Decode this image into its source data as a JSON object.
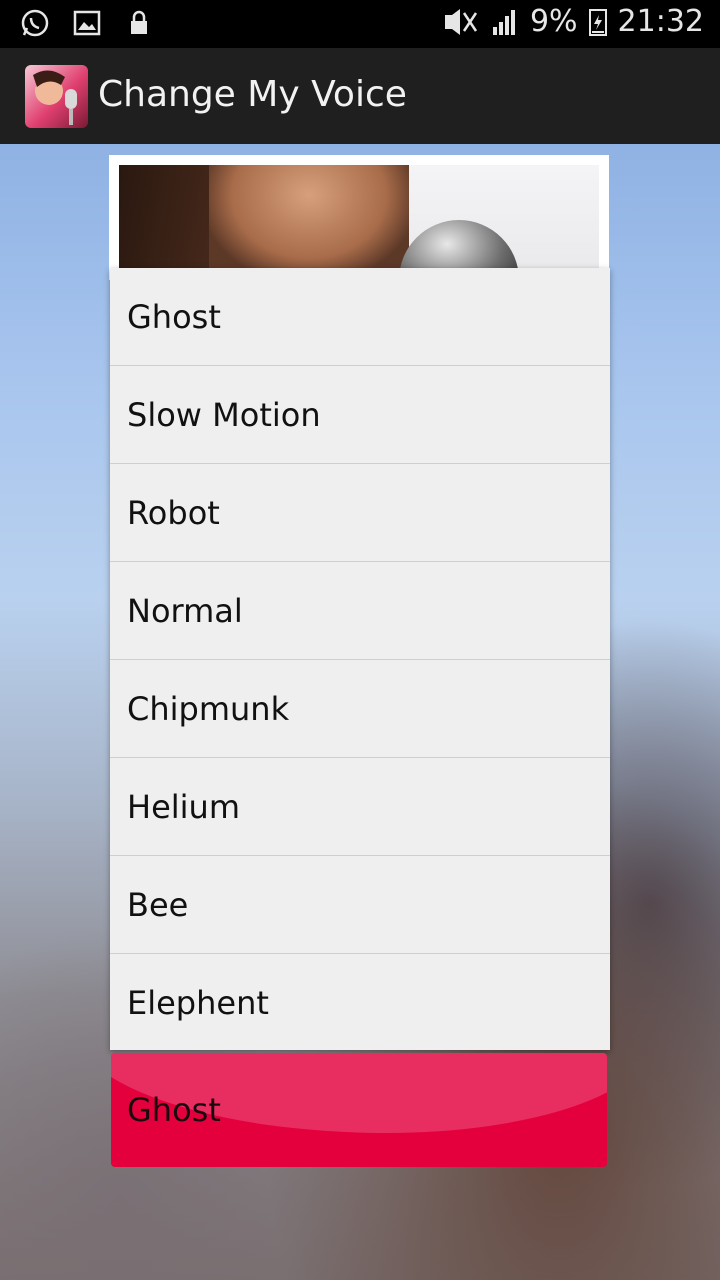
{
  "status_bar": {
    "battery": "9%",
    "time": "21:32",
    "icons": [
      "whatsapp-icon",
      "gallery-icon",
      "lock-icon",
      "mute-icon",
      "signal-icon",
      "battery-icon"
    ]
  },
  "action_bar": {
    "title": "Change My Voice",
    "app_icon": "app-icon"
  },
  "dropdown": {
    "items": [
      "Ghost",
      "Slow Motion",
      "Robot",
      "Normal",
      "Chipmunk",
      "Helium",
      "Bee",
      "Elephent"
    ]
  },
  "spinner": {
    "selected": "Ghost",
    "accent_color": "#e3003d"
  }
}
